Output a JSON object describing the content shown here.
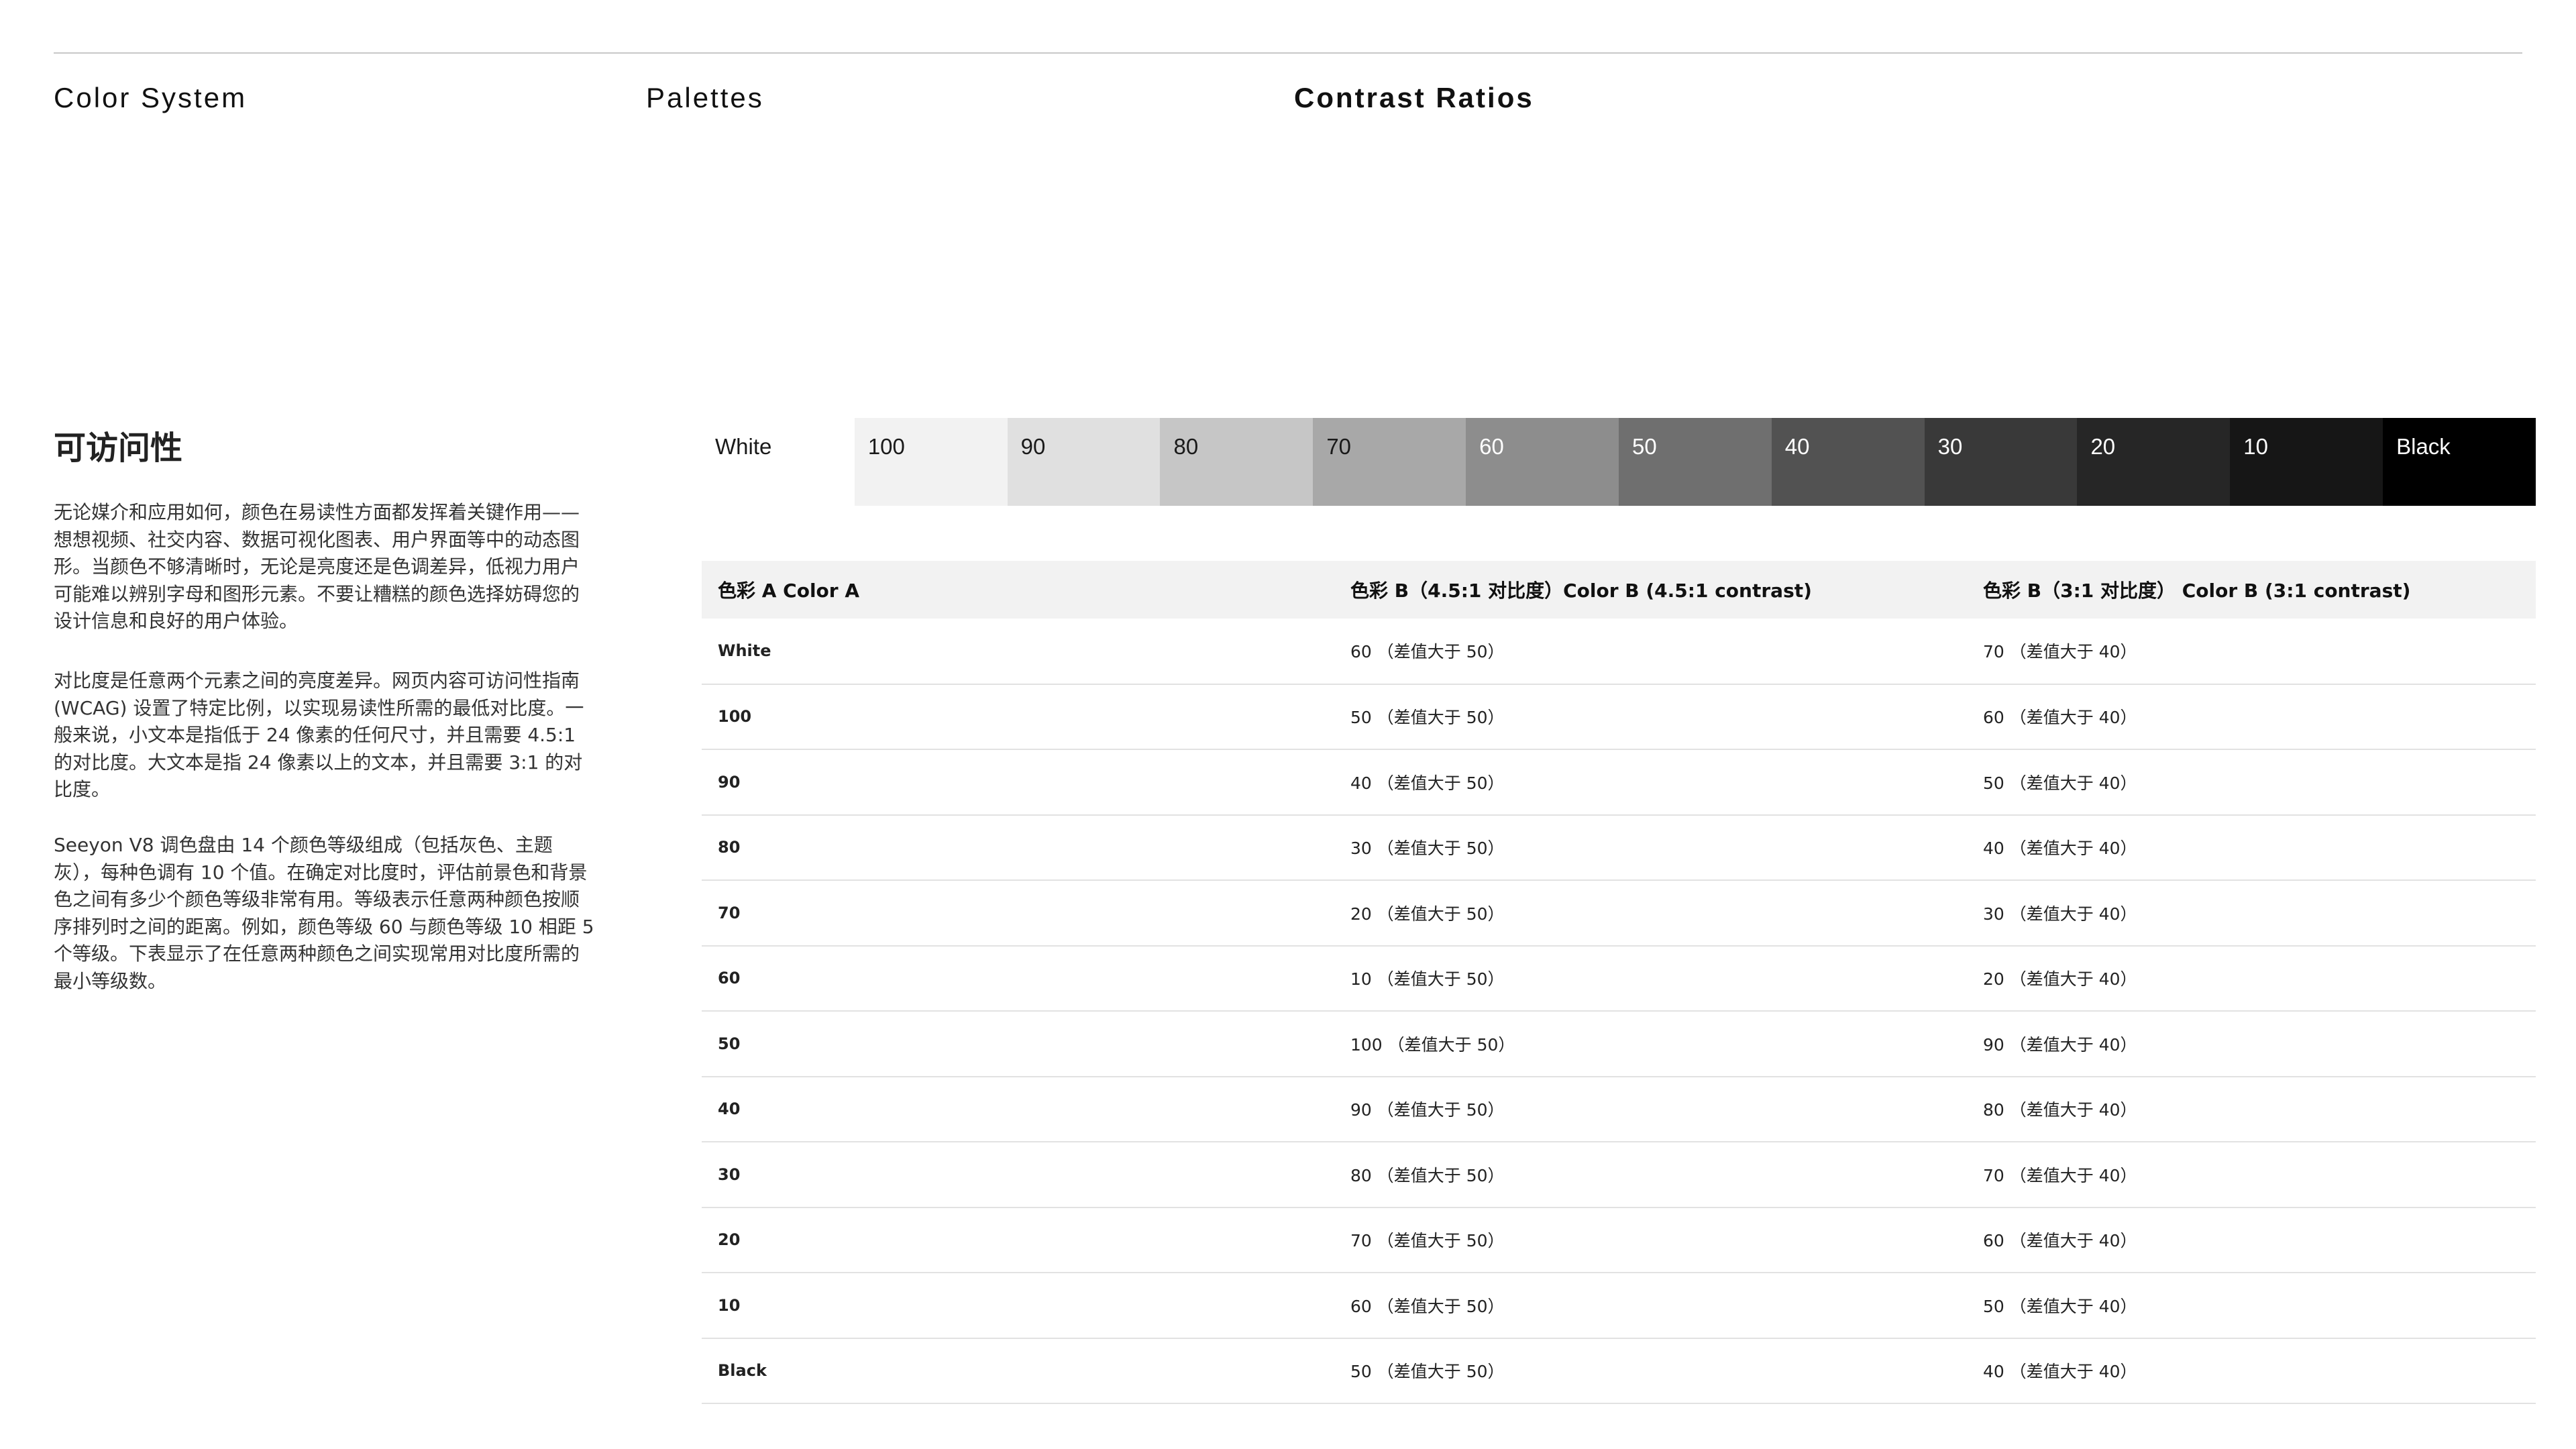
{
  "header": {
    "color_system": "Color System",
    "palettes": "Palettes",
    "contrast_ratios": "Contrast Ratios"
  },
  "section": {
    "title": "可访问性",
    "paragraphs": [
      "无论媒介和应用如何，颜色在易读性方面都发挥着关键作用——想想视频、社交内容、数据可视化图表、用户界面等中的动态图形。当颜色不够清晰时，无论是亮度还是色调差异，低视力用户可能难以辨别字母和图形元素。不要让糟糕的颜色选择妨碍您的设计信息和良好的用户体验。",
      "对比度是任意两个元素之间的亮度差异。网页内容可访问性指南 (WCAG) 设置了特定比例，以实现易读性所需的最低对比度。一般来说，小文本是指低于 24 像素的任何尺寸，并且需要 4.5:1 的对比度。大文本是指 24 像素以上的文本，并且需要 3:1 的对比度。",
      "Seeyon V8 调色盘由 14 个颜色等级组成（包括灰色、主题灰），每种色调有 10 个值。在确定对比度时，评估前景色和背景色之间有多少个颜色等级非常有用。等级表示任意两种颜色按顺序排列时之间的距离。例如，颜色等级 60 与颜色等级 10 相距 5 个等级。下表显示了在任意两种颜色之间实现常用对比度所需的最小等级数。"
    ]
  },
  "palette": {
    "swatches": [
      {
        "label": "White",
        "bg": "#ffffff",
        "fg": "#1a1a1a"
      },
      {
        "label": "100",
        "bg": "#f2f2f2",
        "fg": "#1a1a1a"
      },
      {
        "label": "90",
        "bg": "#e0e0e0",
        "fg": "#1a1a1a"
      },
      {
        "label": "80",
        "bg": "#c6c6c6",
        "fg": "#1a1a1a"
      },
      {
        "label": "70",
        "bg": "#a8a8a8",
        "fg": "#1a1a1a"
      },
      {
        "label": "60",
        "bg": "#8d8d8d",
        "fg": "#ffffff"
      },
      {
        "label": "50",
        "bg": "#6f6f6f",
        "fg": "#ffffff"
      },
      {
        "label": "40",
        "bg": "#525252",
        "fg": "#ffffff"
      },
      {
        "label": "30",
        "bg": "#393939",
        "fg": "#ffffff"
      },
      {
        "label": "20",
        "bg": "#262626",
        "fg": "#ffffff"
      },
      {
        "label": "10",
        "bg": "#161616",
        "fg": "#ffffff"
      },
      {
        "label": "Black",
        "bg": "#000000",
        "fg": "#ffffff"
      }
    ]
  },
  "table": {
    "headers": [
      "色彩 A  Color A",
      "色彩 B（4.5:1 对比度）Color B (4.5:1 contrast)",
      "色彩 B（3:1 对比度） Color B (3:1 contrast)"
    ],
    "rows": [
      [
        "White",
        "60 （差值大于 50）",
        "70 （差值大于 40）"
      ],
      [
        "100",
        "50 （差值大于 50）",
        "60 （差值大于 40）"
      ],
      [
        "90",
        "40 （差值大于 50）",
        "50 （差值大于 40）"
      ],
      [
        "80",
        "30 （差值大于 50）",
        "40 （差值大于 40）"
      ],
      [
        "70",
        "20 （差值大于 50）",
        "30 （差值大于 40）"
      ],
      [
        "60",
        "10 （差值大于 50）",
        "20 （差值大于 40）"
      ],
      [
        "50",
        "100 （差值大于 50）",
        "90 （差值大于 40）"
      ],
      [
        "40",
        "90 （差值大于 50）",
        "80 （差值大于 40）"
      ],
      [
        "30",
        "80 （差值大于 50）",
        "70 （差值大于 40）"
      ],
      [
        "20",
        "70 （差值大于 50）",
        "60 （差值大于 40）"
      ],
      [
        "10",
        "60 （差值大于 50）",
        "50 （差值大于 40）"
      ],
      [
        "Black",
        "50 （差值大于 50）",
        "40 （差值大于 40）"
      ]
    ]
  }
}
